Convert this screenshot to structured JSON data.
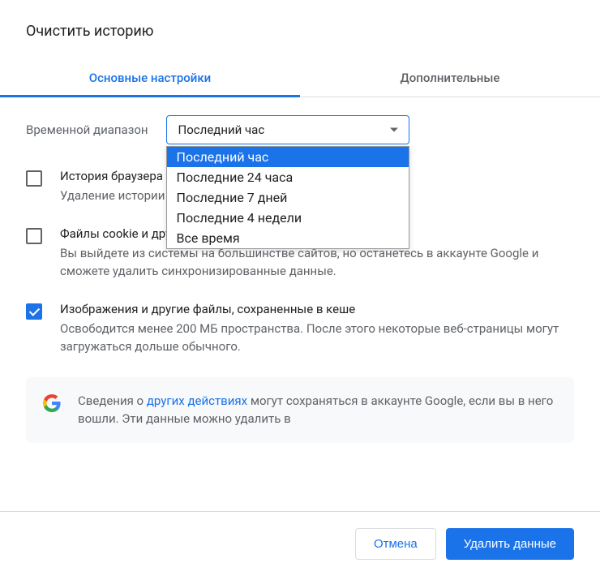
{
  "dialog": {
    "title": "Очистить историю"
  },
  "tabs": {
    "basic": "Основные настройки",
    "advanced": "Дополнительные"
  },
  "timeRange": {
    "label": "Временной диапазон",
    "selected": "Последний час",
    "options": [
      "Последний час",
      "Последние 24 часа",
      "Последние 7 дней",
      "Последние 4 недели",
      "Все время"
    ]
  },
  "checkboxes": [
    {
      "title": "История браузера",
      "desc": "Удаление истории со всех синхронизированных устройств",
      "checked": false
    },
    {
      "title": "Файлы cookie и другие данные сайтов",
      "desc": "Вы выйдете из системы на большинстве сайтов, но останетесь в аккаунте Google и сможете удалить синхронизированные данные.",
      "checked": false
    },
    {
      "title": "Изображения и другие файлы, сохраненные в кеше",
      "desc": "Освободится менее 200 МБ пространства. После этого некоторые веб-страницы могут загружаться дольше обычного.",
      "checked": true
    }
  ],
  "info": {
    "textBefore": "Сведения о ",
    "linkText": "других действиях",
    "textAfter": " могут сохраняться в аккаунте Google, если вы в него вошли. Эти данные можно удалить в"
  },
  "buttons": {
    "cancel": "Отмена",
    "confirm": "Удалить данные"
  }
}
